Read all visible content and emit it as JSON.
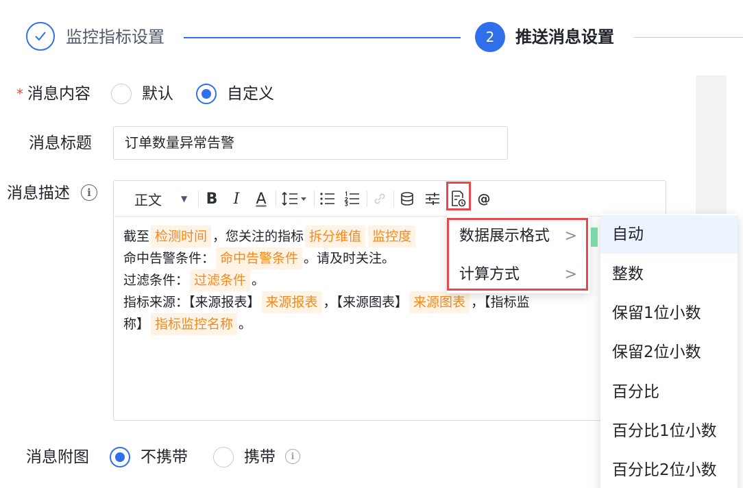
{
  "steps": {
    "step1": {
      "label": "监控指标设置"
    },
    "step2": {
      "number": "2",
      "label": "推送消息设置"
    }
  },
  "form": {
    "content": {
      "required_mark": "*",
      "label": "消息内容",
      "options": [
        "默认",
        "自定义"
      ],
      "selected": "自定义"
    },
    "title": {
      "label": "消息标题",
      "value": "订单数量异常告警"
    },
    "description": {
      "label": "消息描述"
    },
    "attachment": {
      "label": "消息附图",
      "options": [
        "不携带",
        "携带"
      ],
      "selected": "不携带"
    }
  },
  "editor": {
    "toolbar": {
      "paragraph_style": "正文",
      "bold": "B",
      "italic": "I",
      "font_color": "A",
      "mention": "@"
    },
    "lines": [
      [
        {
          "text": "截至"
        },
        {
          "tag": "检测时间"
        },
        {
          "text": "，您关注的指标"
        },
        {
          "tag": "拆分维值"
        },
        {
          "tag": "监控度"
        }
      ],
      [
        {
          "text": "命中告警条件："
        },
        {
          "tag": "命中告警条件"
        },
        {
          "text": "。请及时关注。"
        }
      ],
      [
        {
          "text": "过滤条件："
        },
        {
          "tag": "过滤条件"
        },
        {
          "text": "。"
        }
      ],
      [
        {
          "text": "指标来源：【来源报表】"
        },
        {
          "tag": "来源报表"
        },
        {
          "text": "，【来源图表】"
        },
        {
          "tag": "来源图表"
        },
        {
          "text": "，【指标监"
        }
      ],
      [
        {
          "text": "称】"
        },
        {
          "tag": "指标监控名称"
        },
        {
          "text": "。"
        }
      ]
    ]
  },
  "context_menu": {
    "items": [
      "数据展示格式",
      "计算方式"
    ],
    "chevron": ">"
  },
  "format_submenu": {
    "items": [
      "自动",
      "整数",
      "保留1位小数",
      "保留2位小数",
      "百分比",
      "百分比1位小数",
      "百分比2位小数"
    ],
    "active": "自动"
  },
  "colors": {
    "primary": "#2f6fea",
    "tag_text": "#f7891a",
    "tag_bg": "#fff3e6",
    "highlight": "#e5484d"
  }
}
